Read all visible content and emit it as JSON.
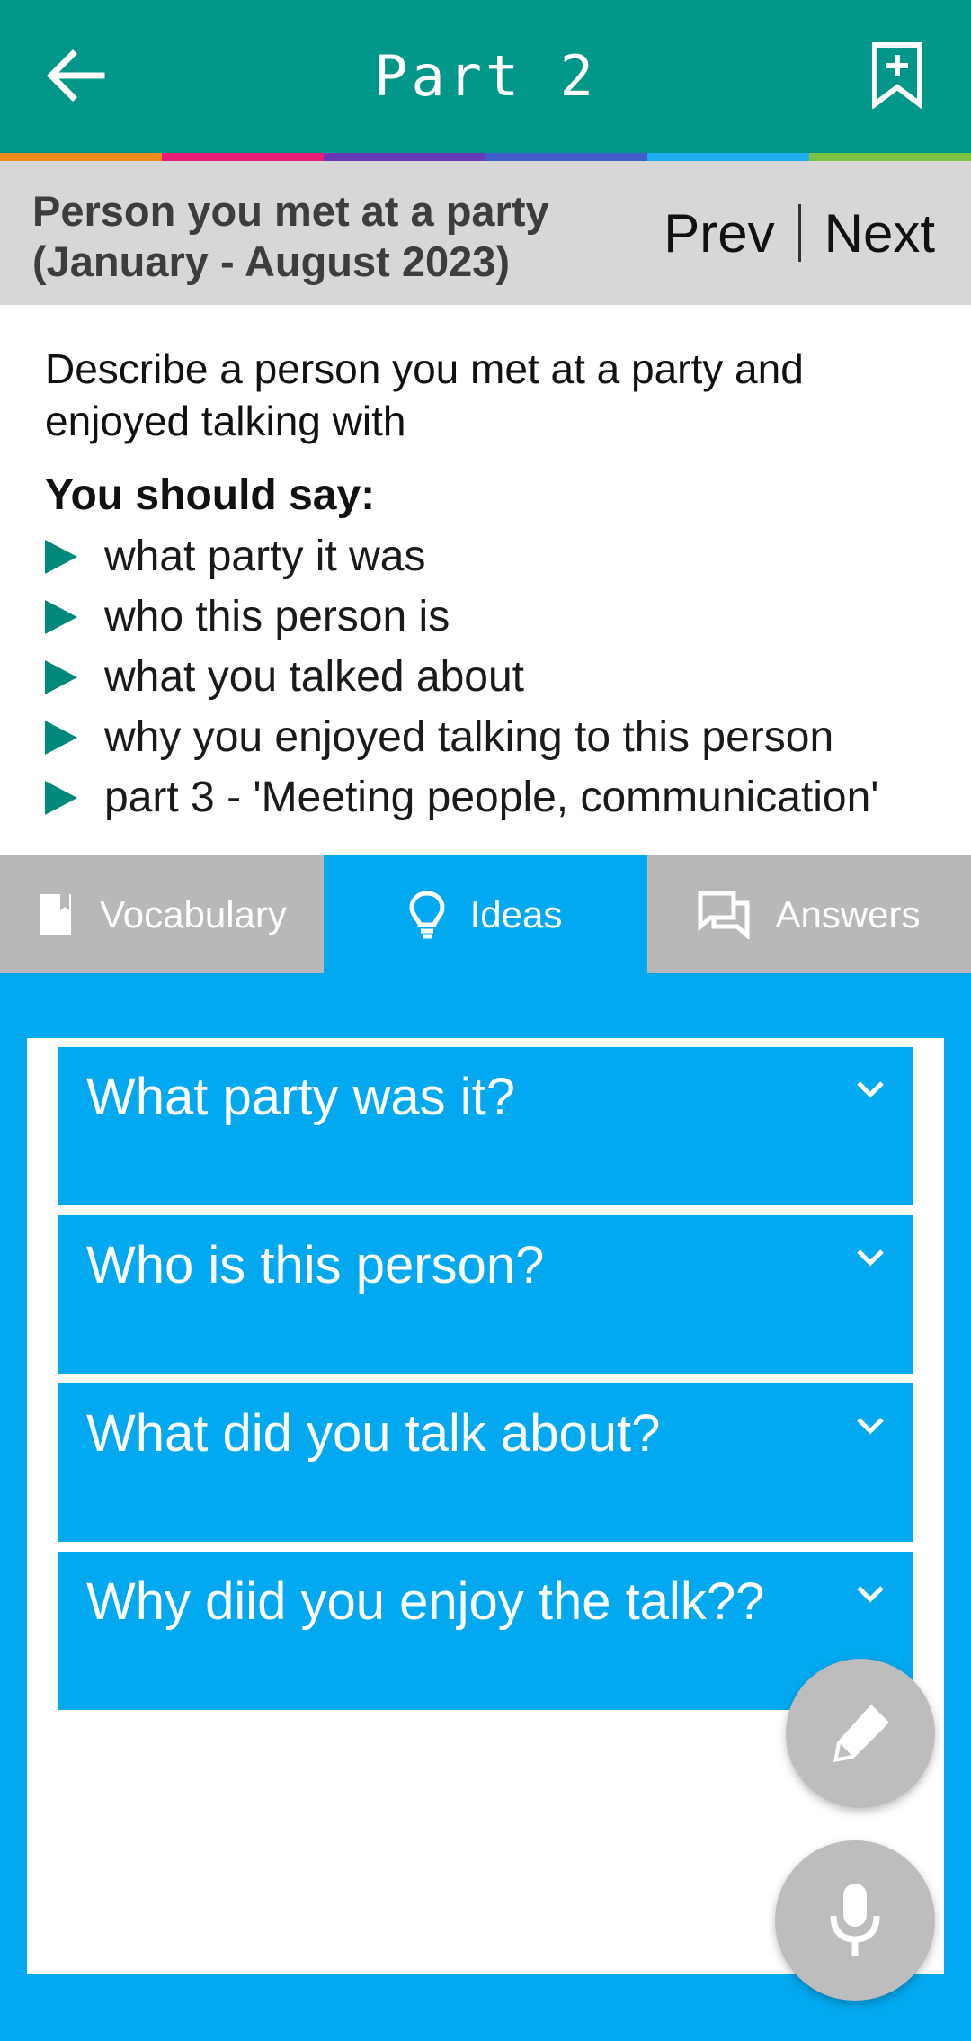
{
  "appbar": {
    "title": "Part 2",
    "back_icon": "arrow-left-icon",
    "bookmark_icon": "bookmark-plus-icon"
  },
  "stripe_colors": [
    "#ef8a1f",
    "#e91e79",
    "#673ab7",
    "#3f5ec9",
    "#1eaef0",
    "#7cc243"
  ],
  "topic": {
    "name": "Person you met at a party (January - August 2023)",
    "prev": "Prev",
    "next": "Next"
  },
  "task": {
    "description": "Describe a person you met at a party and enjoyed talking with",
    "should_say": "You should say:",
    "points": [
      "what party it was",
      "who this person is",
      "what you talked about",
      "why you enjoyed talking to this person",
      "part 3 - 'Meeting people, communication'"
    ]
  },
  "tabs": [
    {
      "label": "Vocabulary",
      "icon": "book-icon"
    },
    {
      "label": "Ideas",
      "icon": "lightbulb-icon"
    },
    {
      "label": "Answers",
      "icon": "chat-icon"
    }
  ],
  "active_tab": "Ideas",
  "accordion": [
    "What party was it?",
    "Who is this person?",
    "What did you talk about?",
    "Why diid you enjoy the talk??"
  ],
  "fabs": {
    "edit_icon": "pencil-icon",
    "mic_icon": "microphone-icon"
  },
  "colors": {
    "appbar": "#009688",
    "accent": "#03a9f0",
    "tab_inactive": "#b8b8b8"
  }
}
